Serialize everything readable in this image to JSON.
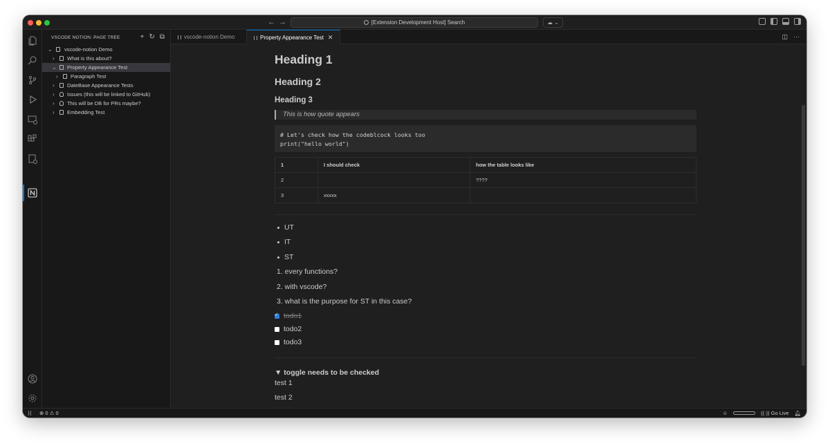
{
  "window": {
    "command_center": "[Extension Development Host] Search"
  },
  "sidebar": {
    "title": "VSCODE NOTION: PAGE TREE",
    "tree": [
      {
        "label": "vscode-notion Demo",
        "kind": "page",
        "expanded": true
      },
      {
        "label": "What is this about?",
        "kind": "page"
      },
      {
        "label": "Property Appearance Test",
        "kind": "page",
        "expanded": true,
        "selected": true
      },
      {
        "label": "Paragraph Test",
        "kind": "page"
      },
      {
        "label": "DateBase Appearance Tests",
        "kind": "page"
      },
      {
        "label": "Issues (this will be linked to GitHub)",
        "kind": "database"
      },
      {
        "label": "This will be DB for PRs maybe?",
        "kind": "database"
      },
      {
        "label": "Embedding Test",
        "kind": "page"
      }
    ]
  },
  "tabs": [
    {
      "label": "vscode-notion Demo",
      "active": false
    },
    {
      "label": "Property Appearance Test",
      "active": true
    }
  ],
  "content": {
    "h1": "Heading 1",
    "h2": "Heading 2",
    "h3": "Heading 3",
    "quote": "This is how quote appears",
    "code_lines": [
      "# Let's check how the codeblcock looks too",
      "print(\"hello world\")"
    ],
    "table": {
      "rows": [
        [
          "1",
          "I should check",
          "how the table looks like"
        ],
        [
          "2",
          "",
          "????"
        ],
        [
          "3",
          "xxxxx",
          ""
        ]
      ]
    },
    "bullets": [
      "UT",
      "IT",
      "ST"
    ],
    "numbered": [
      "1. every functions?",
      "2. with vscode?",
      "3. what is the purpose for ST in this case?"
    ],
    "todos": [
      {
        "text": "todo1",
        "checked": true
      },
      {
        "text": "todo2",
        "checked": false
      },
      {
        "text": "todo3",
        "checked": false
      }
    ],
    "toggle": "▼  toggle needs to be checked",
    "paragraphs": [
      "test 1",
      "test 2"
    ]
  },
  "statusbar": {
    "errors": "0",
    "warnings": "0",
    "go_live": "Go Live"
  },
  "colors": {
    "accent": "#0078d4",
    "editor_bg": "#1f1f1f",
    "sidebar_bg": "#181818",
    "checkbox_checked": "#2f7de1"
  }
}
